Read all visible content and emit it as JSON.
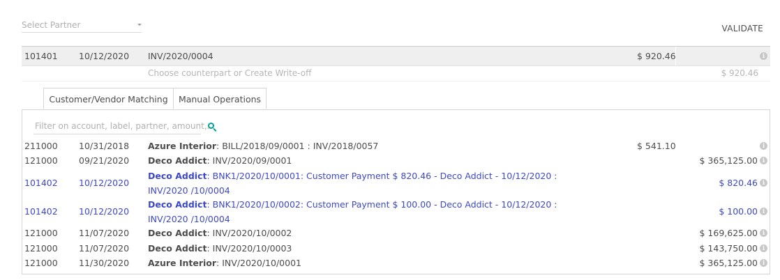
{
  "header": {
    "partner_placeholder": "Select Partner",
    "validate_label": "VALIDATE"
  },
  "statement_line": {
    "account": "101401",
    "date": "10/12/2020",
    "label": "INV/2020/0004",
    "amount": "$ 920.46"
  },
  "counterpart": {
    "prompt": "Choose counterpart or Create Write-off",
    "amount": "$ 920.46"
  },
  "tabs": [
    {
      "label": "Customer/Vendor Matching",
      "active": true
    },
    {
      "label": "Manual Operations",
      "active": false
    }
  ],
  "filter": {
    "placeholder": "Filter on account, label, partner, amount,..."
  },
  "rows": [
    {
      "account": "211000",
      "date": "10/31/2018",
      "partner": "Azure Interior",
      "ref": ": BILL/2018/09/0001 : INV/2018/0057",
      "debit": "$ 541.10",
      "credit": ""
    },
    {
      "account": "121000",
      "date": "09/21/2020",
      "partner": "Deco Addict",
      "ref": ": INV/2020/09/0001",
      "debit": "",
      "credit": "$ 365,125.00"
    },
    {
      "account": "101402",
      "date": "10/12/2020",
      "partner": "Deco Addict",
      "ref": ": BNK1/2020/10/0001: Customer Payment $ 820.46 - Deco Addict - 10/12/2020 : INV/2020 /10/0004",
      "debit": "",
      "credit": "$ 820.46"
    },
    {
      "account": "101402",
      "date": "10/12/2020",
      "partner": "Deco Addict",
      "ref": ": BNK1/2020/10/0002: Customer Payment $ 100.00 - Deco Addict - 10/12/2020 : INV/2020 /10/0004",
      "debit": "",
      "credit": "$ 100.00"
    },
    {
      "account": "121000",
      "date": "11/07/2020",
      "partner": "Deco Addict",
      "ref": ": INV/2020/10/0002",
      "debit": "",
      "credit": "$ 169,625.00"
    },
    {
      "account": "121000",
      "date": "11/07/2020",
      "partner": "Deco Addict",
      "ref": ": INV/2020/10/0003",
      "debit": "",
      "credit": "$ 143,750.00"
    },
    {
      "account": "121000",
      "date": "11/30/2020",
      "partner": "Azure Interior",
      "ref": ": INV/2020/10/0001",
      "debit": "",
      "credit": "$ 365,125.00"
    }
  ],
  "colors": {
    "link": "#3c48c9",
    "accent": "#00a09d",
    "muted": "#b5b5b5"
  },
  "icons": {
    "info": "info-circle-icon",
    "search": "search-icon",
    "dropdown": "caret-down-icon"
  }
}
